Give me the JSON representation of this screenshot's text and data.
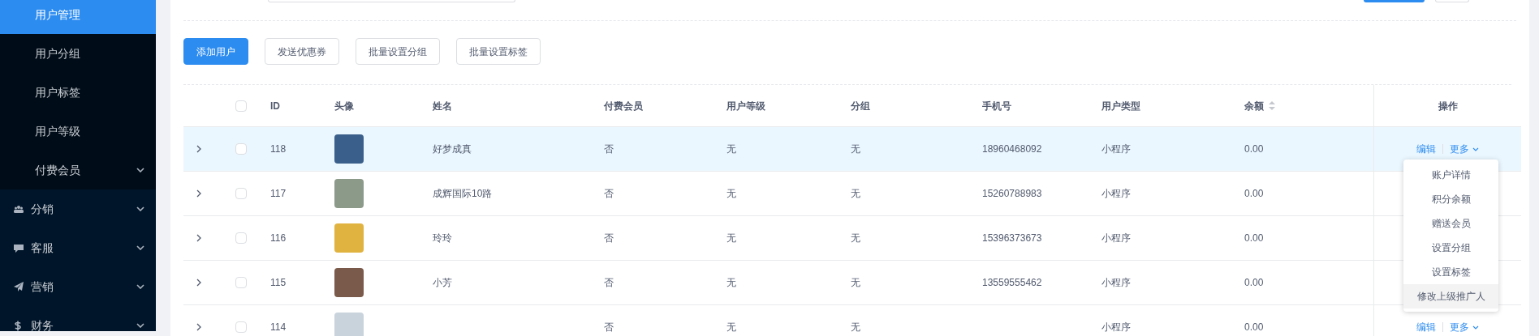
{
  "sidebar": {
    "items": [
      {
        "label": "用户管理",
        "kind": "sub",
        "selected": true,
        "chevron": false
      },
      {
        "label": "用户分组",
        "kind": "sub",
        "selected": false,
        "chevron": false
      },
      {
        "label": "用户标签",
        "kind": "sub",
        "selected": false,
        "chevron": false
      },
      {
        "label": "用户等级",
        "kind": "sub",
        "selected": false,
        "chevron": false
      },
      {
        "label": "付费会员",
        "kind": "sub",
        "selected": false,
        "chevron": true
      },
      {
        "label": "分销",
        "kind": "group",
        "selected": false,
        "chevron": true
      },
      {
        "label": "客服",
        "kind": "group",
        "selected": false,
        "chevron": true
      },
      {
        "label": "营销",
        "kind": "group",
        "selected": false,
        "chevron": true
      },
      {
        "label": "财务",
        "kind": "group",
        "selected": false,
        "chevron": true
      }
    ]
  },
  "toolbar": [
    {
      "label": "添加用户",
      "kind": "primary"
    },
    {
      "label": "发送优惠券",
      "kind": "default"
    },
    {
      "label": "批量设置分组",
      "kind": "default"
    },
    {
      "label": "批量设置标签",
      "kind": "default"
    }
  ],
  "table": {
    "columns": [
      {
        "label": "ID",
        "sortable": false
      },
      {
        "label": "头像",
        "sortable": false
      },
      {
        "label": "姓名",
        "sortable": false
      },
      {
        "label": "付费会员",
        "sortable": false
      },
      {
        "label": "用户等级",
        "sortable": false
      },
      {
        "label": "分组",
        "sortable": false
      },
      {
        "label": "手机号",
        "sortable": false
      },
      {
        "label": "用户类型",
        "sortable": false
      },
      {
        "label": "余额",
        "sortable": true
      },
      {
        "label": "操作",
        "sortable": false
      }
    ],
    "header_checked": false,
    "rows": [
      {
        "id": "118",
        "name": "好梦成真",
        "paid": "否",
        "level": "无",
        "group": "无",
        "phone": "18960468092",
        "type": "小程序",
        "balance": "0.00",
        "checked": false,
        "highlighted": true,
        "actions": [
          "编辑",
          "更多"
        ]
      },
      {
        "id": "117",
        "name": "成辉国际10路",
        "paid": "否",
        "level": "无",
        "group": "无",
        "phone": "15260788983",
        "type": "小程序",
        "balance": "0.00",
        "checked": false,
        "highlighted": false
      },
      {
        "id": "116",
        "name": "玲玲",
        "paid": "否",
        "level": "无",
        "group": "无",
        "phone": "15396373673",
        "type": "小程序",
        "balance": "0.00",
        "checked": false,
        "highlighted": false
      },
      {
        "id": "115",
        "name": "小芳",
        "paid": "否",
        "level": "无",
        "group": "无",
        "phone": "13559555462",
        "type": "小程序",
        "balance": "0.00",
        "checked": false,
        "highlighted": false
      },
      {
        "id": "114",
        "paid": "否",
        "level": "无",
        "group": "无",
        "type": "小程序",
        "balance": "0.00",
        "checked": false,
        "highlighted": false,
        "actions": [
          "编辑",
          "更多"
        ]
      }
    ]
  },
  "dropdown": {
    "items": [
      {
        "label": "账户详情",
        "highlighted": false
      },
      {
        "label": "积分余额",
        "highlighted": false
      },
      {
        "label": "赠送会员",
        "highlighted": false
      },
      {
        "label": "设置分组",
        "highlighted": false
      },
      {
        "label": "设置标签",
        "highlighted": false
      },
      {
        "label": "修改上级推广人",
        "highlighted": true
      }
    ]
  }
}
